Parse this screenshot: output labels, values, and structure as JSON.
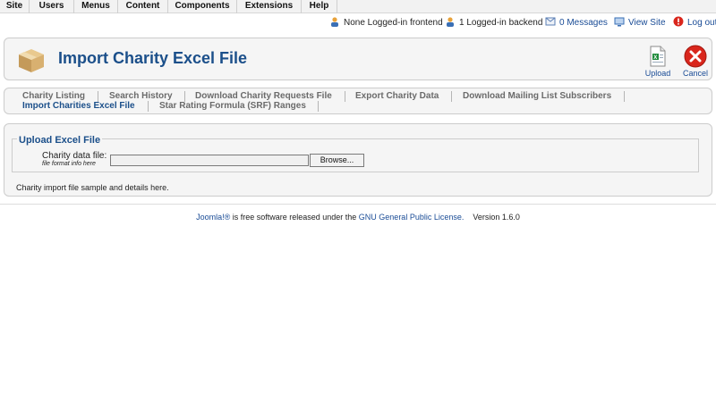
{
  "menu": {
    "items": [
      "Site",
      "Users",
      "Menus",
      "Content",
      "Components",
      "Extensions",
      "Help"
    ]
  },
  "status": {
    "frontend": "None Logged-in frontend",
    "backend": "1 Logged-in backend",
    "messages": "0 Messages",
    "view_site": "View Site",
    "logout": "Log out"
  },
  "header": {
    "title": "Import Charity Excel File",
    "upload_label": "Upload",
    "cancel_label": "Cancel"
  },
  "submenu": {
    "items": [
      "Charity Listing",
      "Search History",
      "Download Charity Requests File",
      "Export Charity Data",
      "Download Mailing List Subscribers",
      "Import Charities Excel File",
      "Star Rating Formula (SRF) Ranges"
    ],
    "active_index": 5
  },
  "form": {
    "legend": "Upload Excel File",
    "field_label": "Charity data file:",
    "field_hint": "file format info here",
    "file_value": "",
    "browse_label": "Browse...",
    "note": "Charity import file sample and details here."
  },
  "footer": {
    "joomla_link": "Joomla!®",
    "text_mid": " is free software released under the ",
    "license_link": "GNU General Public License.",
    "version": "Version 1.6.0"
  },
  "colors": {
    "accent": "#1b4f8a",
    "link": "#1a4c96",
    "cancel": "#d9261c"
  }
}
